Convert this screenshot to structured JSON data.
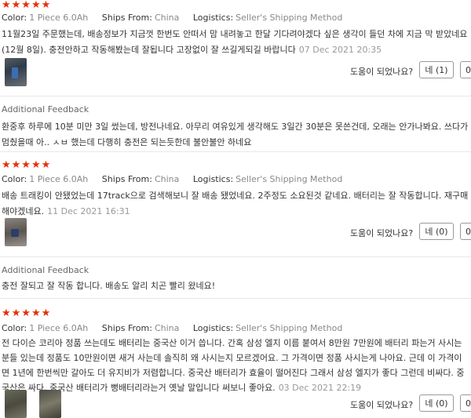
{
  "labels": {
    "color": "Color:",
    "ships_from": "Ships From:",
    "logistics": "Logistics:",
    "helpful": "도움이 되었나요?",
    "additional_feedback": "Additional Feedback"
  },
  "reviews": [
    {
      "stars": "★★★★★",
      "color": "1 Piece 6.0Ah",
      "ships_from": "China",
      "logistics": "Seller's Shipping Method",
      "text": "11월23일 주문했는데, 배송정보가 지금껏 한번도 안떠서 맘 내려놓고 한달 기다려야겠다 싶은 생각이 들던 차에 지금 막 받았네요(12월 8일). 충전안하고 작동해봤는데 잘됩니다 고장없이 잘 쓰길게되길 바랍니다",
      "date": "07 Dec 2021 20:35",
      "yes_label": "네 (1)",
      "no_label": "0",
      "additional_feedback": "환중후 하루에 10분 미만 3일 썼는데, 방전나네요. 아무리 여유있게 생각해도 3일간 30분은 못쓴건데, 오래는 안가나봐요. 쓰다가 멈췄을때 아.. ㅅㅂ 했는데 다행히 충전은 되는듯한데 불안불안 하네요"
    },
    {
      "stars": "★★★★★",
      "color": "1 Piece 6.0Ah",
      "ships_from": "China",
      "logistics": "Seller's Shipping Method",
      "text": "배송 트래킹이 안됐었는데 17track으로 검색해보니 잘 배송 됐었네요. 2주정도 소요된것 같네요. 배터리는 잘 작동합니다. 재구매 해야겠네요.",
      "date": "11 Dec 2021 16:31",
      "yes_label": "네 (0)",
      "no_label": "0",
      "additional_feedback": "충전 잘되고 잘 작동 합니다. 배송도 알리 치곤 빨리 왔네요!"
    },
    {
      "stars": "★★★★★",
      "color": "1 Piece 6.0Ah",
      "ships_from": "China",
      "logistics": "Seller's Shipping Method",
      "text": "전 다이슨 코리아 정품 쓰는데도 배터리는 중국산 이거 씁니다. 간혹 삼성 엘지 이름 붙여서 8만원 7만원에 배터리 파는거 사시는분들 있는데 정품도 10만원이면 새거 사는데 솔직히 왜 사시는지 모르겠어요. 그 가격이면 정품 사시는게 나아요. 근데 이 가격이면 1년에 한번씩만 갈아도 더 유지비가 저렴합니다. 중국산 배터리가 효율이 떨어진다 그래서 삼성 엘지가 좋다 그런데 비싸다. 중국산은 싸다. 중국산 배터리가 뻥배터리라는거 옛날 말입니다 써보니 좋아요.",
      "date": "03 Dec 2021 22:19",
      "yes_label": "네 (0)",
      "no_label": "0"
    }
  ]
}
